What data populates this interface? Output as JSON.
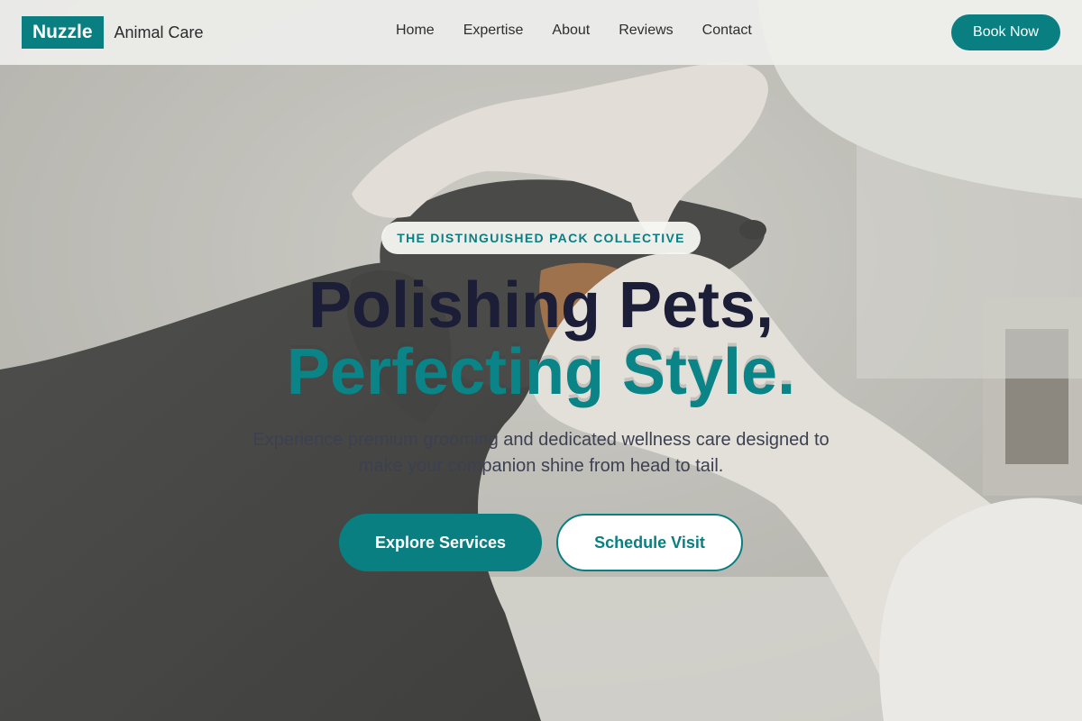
{
  "brand": {
    "name": "Nuzzle",
    "subtitle": "Animal Care"
  },
  "nav": {
    "links": [
      "Home",
      "Expertise",
      "About",
      "Reviews",
      "Contact"
    ],
    "cta": "Book Now"
  },
  "hero": {
    "tagline": "THE DISTINGUISHED PACK COLLECTIVE",
    "headline_line1": "Polishing Pets,",
    "headline_line2": "Perfecting Style.",
    "subtext": "Experience premium grooming and dedicated wellness care designed to make your companion shine from head to tail.",
    "primary_button": "Explore Services",
    "secondary_button": "Schedule Visit"
  },
  "colors": {
    "accent": "#0a7f81",
    "headline_dark": "#1c1d36",
    "headline_teal": "#0a8486"
  },
  "image": {
    "subject": "hero-photo-vet-gloved-hands-dachshund"
  }
}
